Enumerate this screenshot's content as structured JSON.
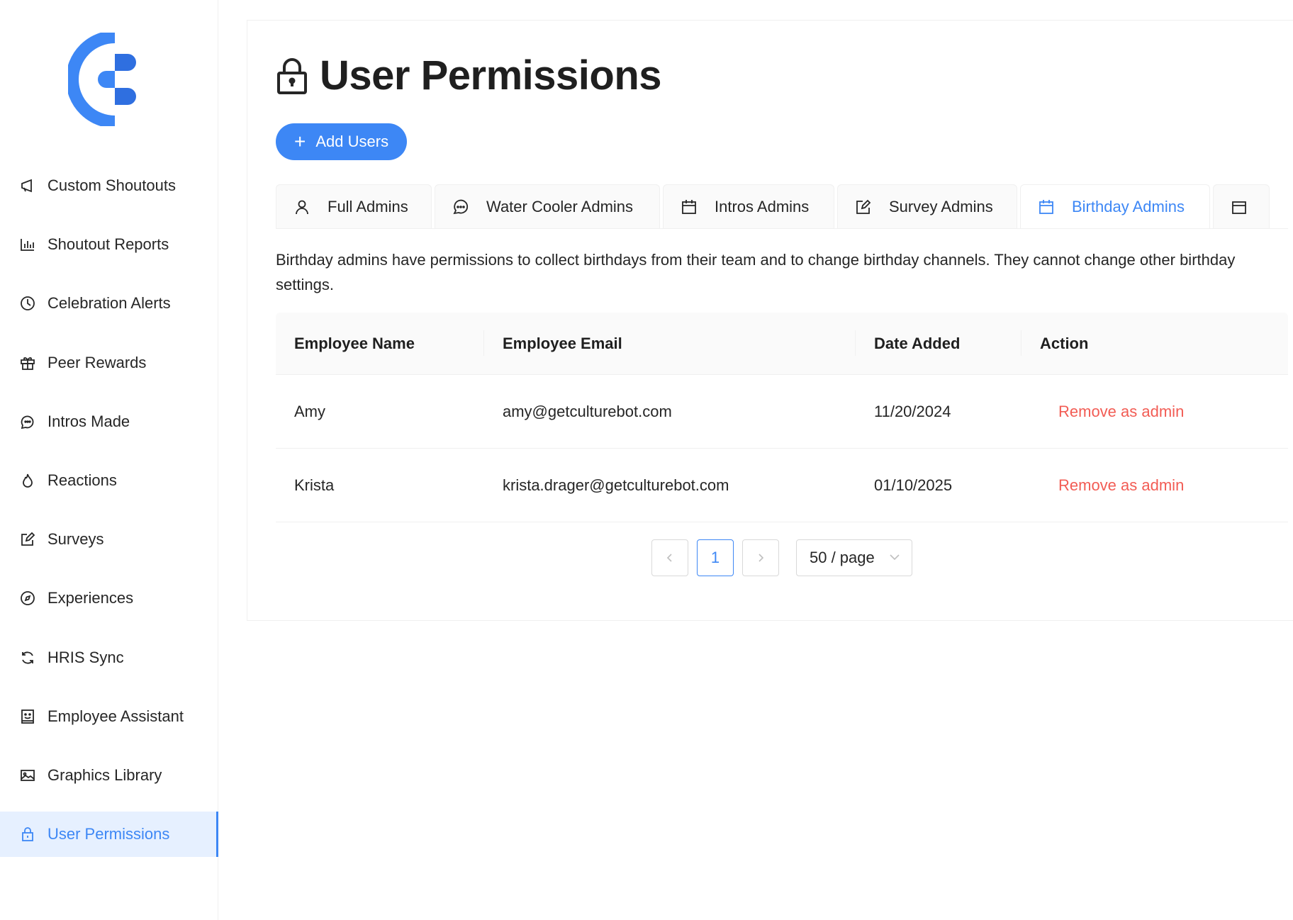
{
  "brand": {
    "accent": "#3d87f5",
    "danger": "#f25c54",
    "logo_color": "#3d87f5"
  },
  "sidebar": {
    "items": [
      {
        "label": "Custom Shoutouts",
        "icon": "megaphone-icon"
      },
      {
        "label": "Shoutout Reports",
        "icon": "bar-chart-icon"
      },
      {
        "label": "Celebration Alerts",
        "icon": "clock-icon"
      },
      {
        "label": "Peer Rewards",
        "icon": "gift-icon"
      },
      {
        "label": "Intros Made",
        "icon": "chat-bubbles-icon"
      },
      {
        "label": "Reactions",
        "icon": "fire-icon"
      },
      {
        "label": "Surveys",
        "icon": "edit-icon"
      },
      {
        "label": "Experiences",
        "icon": "compass-icon"
      },
      {
        "label": "HRIS Sync",
        "icon": "sync-icon"
      },
      {
        "label": "Employee Assistant",
        "icon": "robot-icon"
      },
      {
        "label": "Graphics Library",
        "icon": "image-icon"
      },
      {
        "label": "User Permissions",
        "icon": "lock-icon",
        "active": true
      }
    ]
  },
  "page": {
    "title": "User Permissions",
    "title_icon": "lock-icon",
    "add_button": "Add Users",
    "tabs": [
      {
        "label": "Full Admins",
        "icon": "user-icon"
      },
      {
        "label": "Water Cooler Admins",
        "icon": "chat-bubbles-icon"
      },
      {
        "label": "Intros Admins",
        "icon": "calendar-icon"
      },
      {
        "label": "Survey Admins",
        "icon": "edit-icon"
      },
      {
        "label": "Birthday Admins",
        "icon": "calendar-icon",
        "active": true
      }
    ],
    "description": "Birthday admins have permissions to collect birthdays from their team and to change birthday channels. They cannot change other birthday settings."
  },
  "table": {
    "headers": [
      "Employee Name",
      "Employee Email",
      "Date Added",
      "Action"
    ],
    "rows": [
      {
        "name": "Amy",
        "email": "amy@getculturebot.com",
        "date": "11/20/2024",
        "action": "Remove as admin"
      },
      {
        "name": "Krista",
        "email": "krista.drager@getculturebot.com",
        "date": "01/10/2025",
        "action": "Remove as admin"
      }
    ]
  },
  "pagination": {
    "current_page": "1",
    "prev": "<",
    "next": ">",
    "page_size": "50 / page"
  }
}
